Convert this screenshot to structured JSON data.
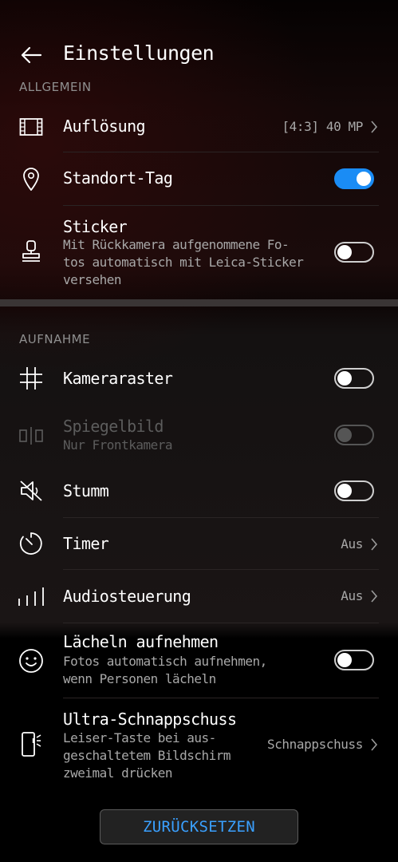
{
  "header": {
    "title": "Einstellungen",
    "back_icon": "arrow-left-icon"
  },
  "sections": {
    "general": "ALLGEMEIN",
    "capture": "AUFNAHME"
  },
  "general_items": {
    "resolution": {
      "label": "Auflösung",
      "value": "[4:3] 40 MP",
      "icon": "film-frame-icon"
    },
    "location": {
      "label": "Standort-Tag",
      "toggle": true,
      "icon": "location-pin-icon"
    },
    "sticker": {
      "label": "Sticker",
      "desc_line1": "Mit Rückkamera aufgenommene Fo-",
      "desc_line2": "tos automatisch mit Leica-Sticker",
      "desc_line3": "versehen",
      "toggle": false,
      "icon": "stamp-icon"
    }
  },
  "capture_items": {
    "grid": {
      "label": "Kameraraster",
      "toggle": false,
      "icon": "grid-icon"
    },
    "mirror": {
      "label": "Spiegelbild",
      "desc": "Nur Frontkamera",
      "toggle": false,
      "disabled": true,
      "icon": "mirror-icon"
    },
    "mute": {
      "label": "Stumm",
      "toggle": false,
      "icon": "speaker-mute-icon"
    },
    "timer": {
      "label": "Timer",
      "value": "Aus",
      "icon": "timer-icon"
    },
    "audio": {
      "label": "Audiosteuerung",
      "value": "Aus",
      "icon": "audio-bars-icon"
    },
    "smile": {
      "label": "Lächeln aufnehmen",
      "desc_line1": "Fotos automatisch aufnehmen,",
      "desc_line2": "wenn Personen lächeln",
      "toggle": false,
      "icon": "smiley-icon"
    },
    "snapshot": {
      "label": "Ultra-Schnappschuss",
      "desc_line1": "Leiser-Taste bei aus-",
      "desc_line2": "geschaltetem Bildschirm",
      "desc_line3": "zweimal drücken",
      "value": "Schnappschuss",
      "icon": "phone-volume-icon"
    }
  },
  "reset_button": "ZURÜCKSETZEN",
  "colors": {
    "accent": "#1a8cf5",
    "reset_text": "#3aa0ff"
  }
}
